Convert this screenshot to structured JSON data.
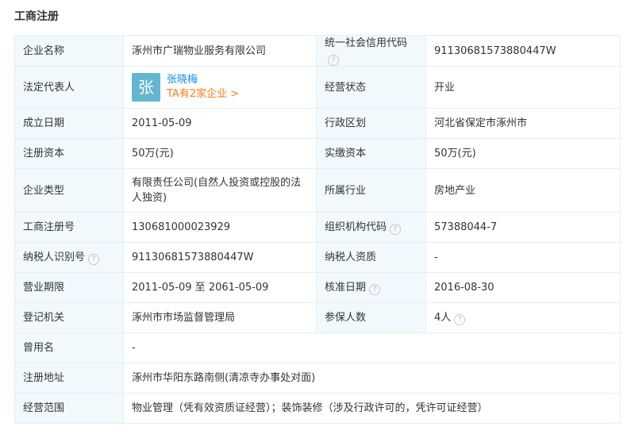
{
  "section_title": "工商注册",
  "rows": [
    {
      "l1": "企业名称",
      "v1": "涿州市广瑞物业服务有限公司",
      "l2": "统一社会信用代码",
      "v2": "91130681573880447W"
    },
    {
      "l1": "法定代表人",
      "l2": "经营状态",
      "v2": "开业"
    },
    {
      "l1": "成立日期",
      "v1": "2011-05-09",
      "l2": "行政区划",
      "v2": "河北省保定市涿州市"
    },
    {
      "l1": "注册资本",
      "v1": "50万(元)",
      "l2": "实缴资本",
      "v2": "50万(元)"
    },
    {
      "l1": "企业类型",
      "v1": "有限责任公司(自然人投资或控股的法人独资)",
      "l2": "所属行业",
      "v2": "房地产业"
    },
    {
      "l1": "工商注册号",
      "v1": "130681000023929",
      "l2": "组织机构代码",
      "v2": "57388044-7"
    },
    {
      "l1": "纳税人识别号",
      "v1": "91130681573880447W",
      "l2": "纳税人资质",
      "v2": "-"
    },
    {
      "l1": "营业期限",
      "v1": "2011-05-09 至 2061-05-09",
      "l2": "核准日期",
      "v2": "2016-08-30"
    },
    {
      "l1": "登记机关",
      "v1": "涿州市市场监督管理局",
      "l2": "参保人数",
      "v2": "4人"
    },
    {
      "l1": "曾用名",
      "v1": "-"
    },
    {
      "l1": "注册地址",
      "v1": "涿州市华阳东路南侧(清凉寺办事处对面)"
    },
    {
      "l1": "经营范围",
      "v1": "物业管理（凭有效资质证经营）；装饰装修（涉及行政许可的，凭许可证经营）"
    }
  ],
  "legal_rep": {
    "avatar_char": "张",
    "name": "张晓梅",
    "link": "TA有2家企业 >"
  },
  "help_icon": "?",
  "colors": {
    "label_bg": "#f2f9fc",
    "border": "#e4eef6",
    "link_blue": "#128bed",
    "link_orange": "#fd7e14",
    "avatar_bg": "#64b5cf"
  }
}
